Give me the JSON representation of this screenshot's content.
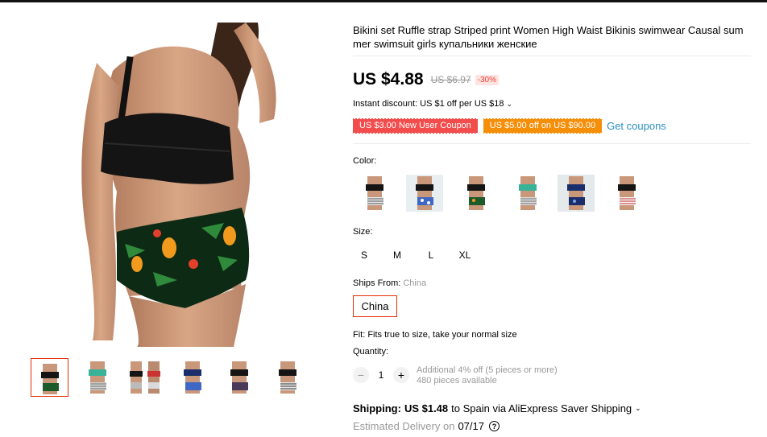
{
  "product": {
    "title": "Bikini set Ruffle strap Striped print Women High Waist Bikinis swimwear Causal summer swimsuit girls купальники женские",
    "price": "US $4.88",
    "original_price": "US $6.97",
    "discount": "-30%",
    "instant_discount": "Instant discount: US $1 off per US $18",
    "coupons": [
      {
        "label": "US $3.00 New User Coupon",
        "color": "#f34c4c"
      },
      {
        "label": "US $5.00 off on US $90.00",
        "color": "#f58f0a"
      }
    ],
    "get_coupons": "Get coupons",
    "color_label": "Color:",
    "colors": [
      {
        "name": "white-striped",
        "icon": "swatch-white-striped"
      },
      {
        "name": "blue-floral",
        "icon": "swatch-blue-floral"
      },
      {
        "name": "green-tropical",
        "icon": "swatch-green-tropical"
      },
      {
        "name": "mint-striped",
        "icon": "swatch-mint-striped"
      },
      {
        "name": "navy-floral",
        "icon": "swatch-navy-floral"
      },
      {
        "name": "red-striped",
        "icon": "swatch-red-striped"
      }
    ],
    "size_label": "Size:",
    "sizes": [
      "S",
      "M",
      "L",
      "XL"
    ],
    "ships_from_label": "Ships From:",
    "ships_from_value": "China",
    "ships_option": "China",
    "fit": "Fit: Fits true to size, take your normal size",
    "quantity_label": "Quantity:",
    "quantity": "1",
    "qty_minus": "−",
    "qty_plus": "+",
    "qty_note_1": "Additional 4% off (5 pieces or more)",
    "qty_note_2": "480 pieces available",
    "shipping_label": "Shipping:",
    "shipping_price": "US $1.48",
    "shipping_rest": "to Spain via AliExpress Saver Shipping",
    "delivery_label": "Estimated Delivery on",
    "delivery_date": "07/17",
    "accent": "#e62e04",
    "link_color": "#2a8fbd"
  }
}
